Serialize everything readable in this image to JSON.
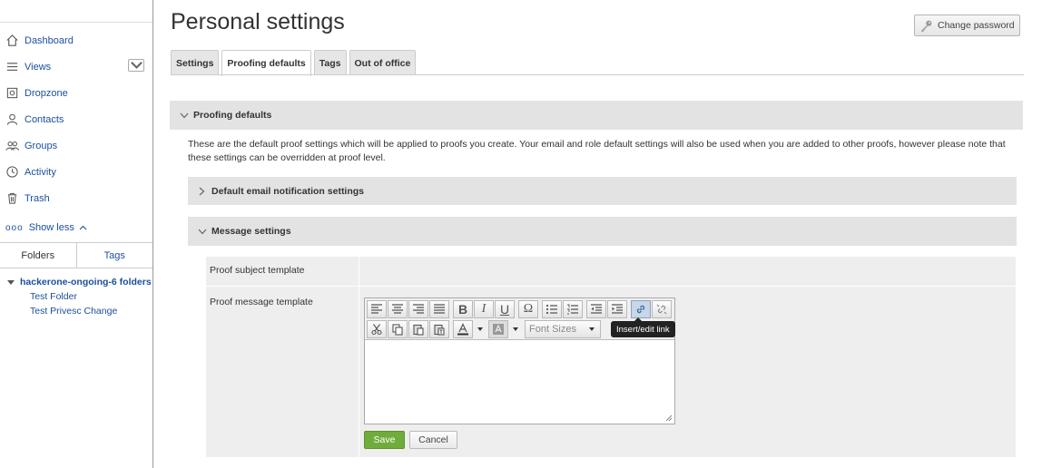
{
  "sidebar": {
    "nav": [
      {
        "label": "Dashboard",
        "icon": "home-icon"
      },
      {
        "label": "Views",
        "icon": "list-icon"
      },
      {
        "label": "Dropzone",
        "icon": "dropzone-icon"
      },
      {
        "label": "Contacts",
        "icon": "contact-icon"
      },
      {
        "label": "Groups",
        "icon": "groups-icon"
      },
      {
        "label": "Activity",
        "icon": "clock-icon"
      },
      {
        "label": "Trash",
        "icon": "trash-icon"
      }
    ],
    "show_less": "Show less",
    "tabs": {
      "folders": "Folders",
      "tags": "Tags"
    },
    "tree": {
      "root": "hackerone-ongoing-6 folders",
      "children": [
        "Test Folder",
        "Test Privesc Change"
      ]
    }
  },
  "header": {
    "title": "Personal settings",
    "change_password": "Change password"
  },
  "tabs": [
    "Settings",
    "Proofing defaults",
    "Tags",
    "Out of office"
  ],
  "active_tab": "Proofing defaults",
  "proofing": {
    "section_title": "Proofing defaults",
    "description": "These are the default proof settings which will be applied to proofs you create. Your email and role default settings will also be used when you are added to other proofs, however please note that these settings can be overridden at proof level.",
    "email_section": "Default email notification settings",
    "message_section": "Message settings",
    "subject_label": "Proof subject template",
    "message_label": "Proof message template",
    "font_sizes_placeholder": "Font Sizes",
    "tooltip": "Insert/edit link",
    "save": "Save",
    "cancel": "Cancel"
  },
  "colors": {
    "link": "#1a4f9c",
    "save": "#6fac3b",
    "section_bg": "#e3e3e3"
  }
}
